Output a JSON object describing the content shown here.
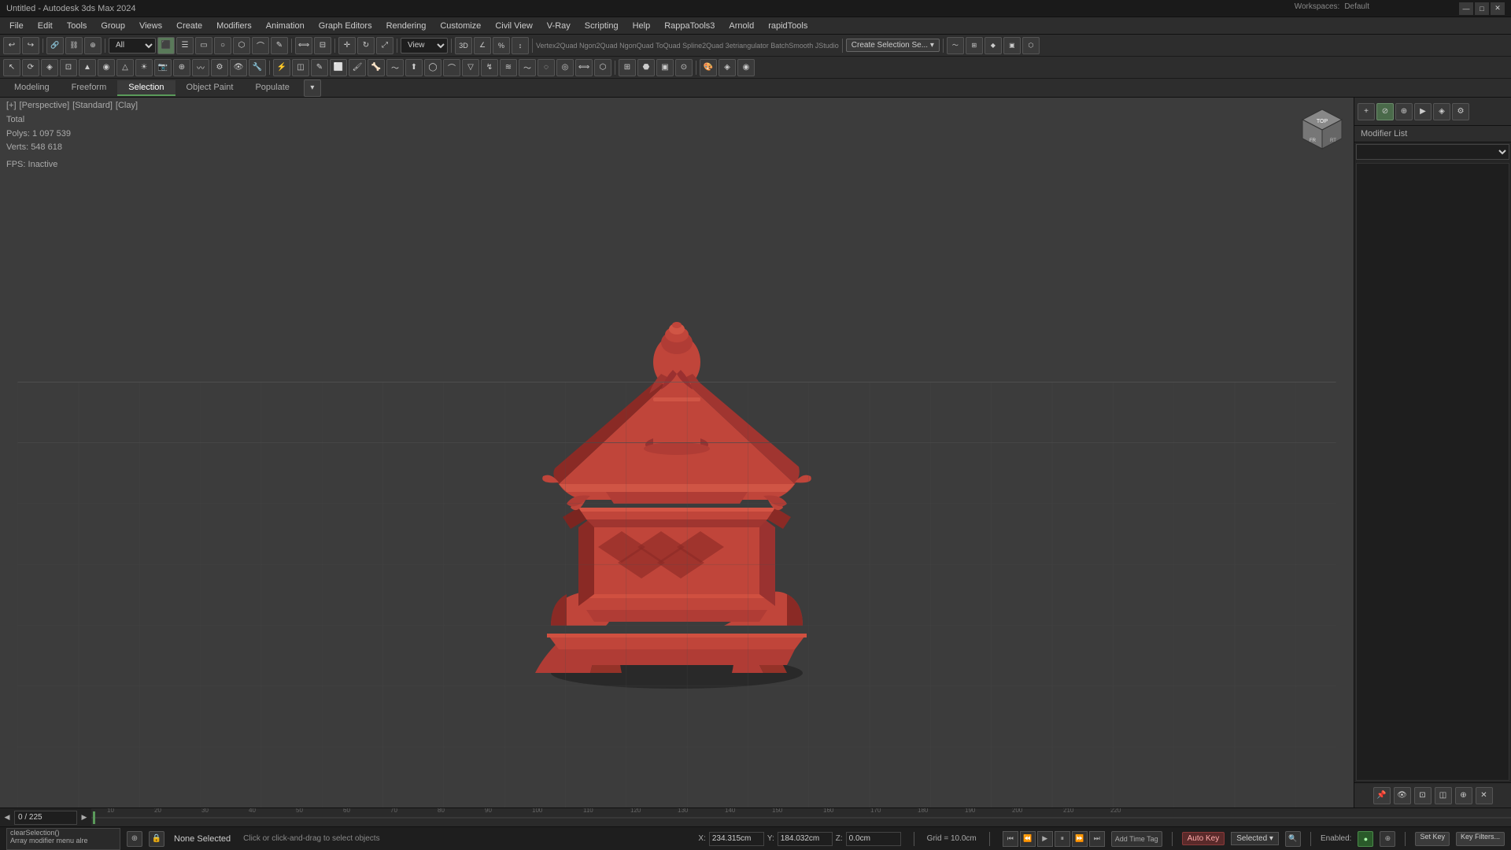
{
  "title_bar": {
    "title": "Untitled - Autodesk 3ds Max 2024",
    "minimize_label": "—",
    "maximize_label": "□",
    "close_label": "✕",
    "workspaces_label": "Workspaces:",
    "workspace_name": "Default"
  },
  "menu": {
    "items": [
      "File",
      "Edit",
      "Tools",
      "Group",
      "Views",
      "Create",
      "Modifiers",
      "Animation",
      "Graph Editors",
      "Rendering",
      "Customize",
      "Civil View",
      "V-Ray",
      "Scripting",
      "Help",
      "RappaTools3",
      "Arnold",
      "rapidTools"
    ]
  },
  "toolbar1": {
    "layer_dropdown": "All",
    "view_dropdown": "View",
    "create_selection_btn": "Create Selection Se...",
    "snaps_label": "Vertex2Quad  Ngon2Quad  NgonQuad  ToQuad  Spline2Quad  3etriangulator  BatchSmooth  JStudio"
  },
  "tabs": {
    "items": [
      "Modeling",
      "Freeform",
      "Selection",
      "Object Paint",
      "Populate"
    ],
    "active": "Selection"
  },
  "viewport": {
    "header": "[+] [Perspective] [Standard] [Clay]",
    "stats": {
      "total_label": "Total",
      "polys_label": "Polys:",
      "polys_value": "1 097 539",
      "verts_label": "Verts:",
      "verts_value": "548 618",
      "fps_label": "FPS:",
      "fps_value": "Inactive"
    }
  },
  "right_panel": {
    "modifier_list_label": "Modifier List"
  },
  "timeline": {
    "current_frame": "0 / 225",
    "ticks": [
      "10",
      "20",
      "30",
      "40",
      "50",
      "60",
      "70",
      "80",
      "90",
      "100",
      "110",
      "120",
      "130",
      "140",
      "150",
      "160",
      "170",
      "180",
      "190",
      "200",
      "210",
      "220"
    ]
  },
  "status_bar": {
    "script_text": "clearSelection()\nArray modifier menu alre",
    "selection_status": "None Selected",
    "hint_text": "Click or click-and-drag to select objects",
    "coord_x_label": "X:",
    "coord_x_value": "234.315cm",
    "coord_y_label": "Y:",
    "coord_y_value": "184.032cm",
    "coord_z_label": "Z:",
    "coord_z_value": "0.0cm",
    "grid_label": "Grid = 10.0cm",
    "add_time_tag": "Add Time Tag",
    "auto_key_label": "Auto Key",
    "selected_label": "Selected",
    "enabled_label": "Enabled:",
    "set_key_label": "Set Key",
    "key_filters_label": "Key Filters..."
  },
  "colors": {
    "bg_dark": "#1e1e1e",
    "bg_medium": "#2d2d2d",
    "bg_light": "#3a3a3a",
    "accent_green": "#5a9a5a",
    "lantern_color": "#c0453a",
    "lantern_shadow": "#8a2a25",
    "grid_color": "#4a4a4a",
    "viewport_bg": "#3c3c3c"
  }
}
